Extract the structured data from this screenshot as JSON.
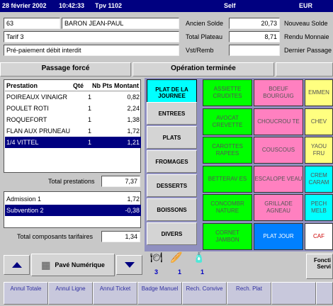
{
  "topbar": {
    "date": "28 février 2002",
    "time": "10:42:33",
    "terminal": "Tpv 1102",
    "mode": "Self",
    "currency": "EUR"
  },
  "customer": {
    "number": "63",
    "name": "BARON JEAN-PAUL",
    "tariff": "Tarif 3",
    "payment": "Pré-paiement débit interdit"
  },
  "totals": {
    "ancien_solde_label": "Ancien Solde",
    "ancien_solde": "20,73",
    "total_plateau_label": "Total Plateau",
    "total_plateau": "8,71",
    "vst_label": "Vst/Remb",
    "vst": "",
    "nouveau_solde_label": "Nouveau Solde",
    "rendu_monnaie_label": "Rendu Monnaie",
    "dernier_passage_label": "Dernier Passage"
  },
  "tabs": {
    "passage_force": "Passage forcé",
    "operation_terminee": "Opération terminée"
  },
  "grid": {
    "headers": [
      "Prestation",
      "Qté",
      "Nb Pts",
      "Montant"
    ],
    "rows": [
      {
        "name": "POIREAUX VINAIGR",
        "qty": "1",
        "pts": "",
        "amount": "0,82"
      },
      {
        "name": "POULET ROTI",
        "qty": "1",
        "pts": "",
        "amount": "2,24"
      },
      {
        "name": "ROQUEFORT",
        "qty": "1",
        "pts": "",
        "amount": "1,38"
      },
      {
        "name": "FLAN AUX PRUNEAU",
        "qty": "1",
        "pts": "",
        "amount": "1,72"
      },
      {
        "name": "1/4 VITTEL",
        "qty": "1",
        "pts": "",
        "amount": "1,21"
      }
    ],
    "total_prestations_label": "Total prestations",
    "total_prestations": "7,37"
  },
  "components": {
    "rows": [
      {
        "name": "Admission 1",
        "amount": "1,72"
      },
      {
        "name": "Subvention 2",
        "amount": "-0,38"
      }
    ],
    "total_label": "Total composants tarifaires",
    "total": "1,34"
  },
  "categories": [
    "PLAT DE LA JOURNEE",
    "ENTREES",
    "PLATS",
    "FROMAGES",
    "DESSERTS",
    "BOISSONS",
    "DIVERS"
  ],
  "tiles": [
    {
      "label": "ASSIETTE CRUDITES",
      "color": "#00ff00"
    },
    {
      "label": "BOEUF BOURGUIG",
      "color": "#ff80c0"
    },
    {
      "label": "EMMEN",
      "color": "#ffff80"
    },
    {
      "label": "AVOCAT CREVETTE",
      "color": "#00ff00"
    },
    {
      "label": "CHOUCROU TE",
      "color": "#ff80c0"
    },
    {
      "label": "CHEV",
      "color": "#ffff80"
    },
    {
      "label": "CAROTTES RAPEES",
      "color": "#00ff00"
    },
    {
      "label": "COUSCOUS",
      "color": "#ff80c0"
    },
    {
      "label": "YAOU FRU",
      "color": "#ffff80"
    },
    {
      "label": "BETTERAV ES",
      "color": "#00ff00"
    },
    {
      "label": "ESCALOPE VEAU",
      "color": "#ff80c0"
    },
    {
      "label": "CREM CARAM",
      "color": "#00ffff"
    },
    {
      "label": "CONCOMBR NATURE",
      "color": "#00ff00"
    },
    {
      "label": "GRILLADE AGNEAU",
      "color": "#ff80c0"
    },
    {
      "label": "PECH MELB",
      "color": "#00ffff"
    },
    {
      "label": "CORNET JAMBON",
      "color": "#00ff00"
    },
    {
      "label": "PLAT JOUR",
      "color": "#0080ff"
    },
    {
      "label": "CAF",
      "color": "#ffffff"
    }
  ],
  "bottom": {
    "pave_label": "Pavé Numérique",
    "icon_counts": [
      "3",
      "1",
      "1"
    ],
    "fonction_label": "Foncti Servi"
  },
  "fbuttons": [
    "Annul Totale",
    "Annul Ligne",
    "Annul Ticket",
    "Badge Manuel",
    "Rech. Convive",
    "Rech. Plat"
  ]
}
